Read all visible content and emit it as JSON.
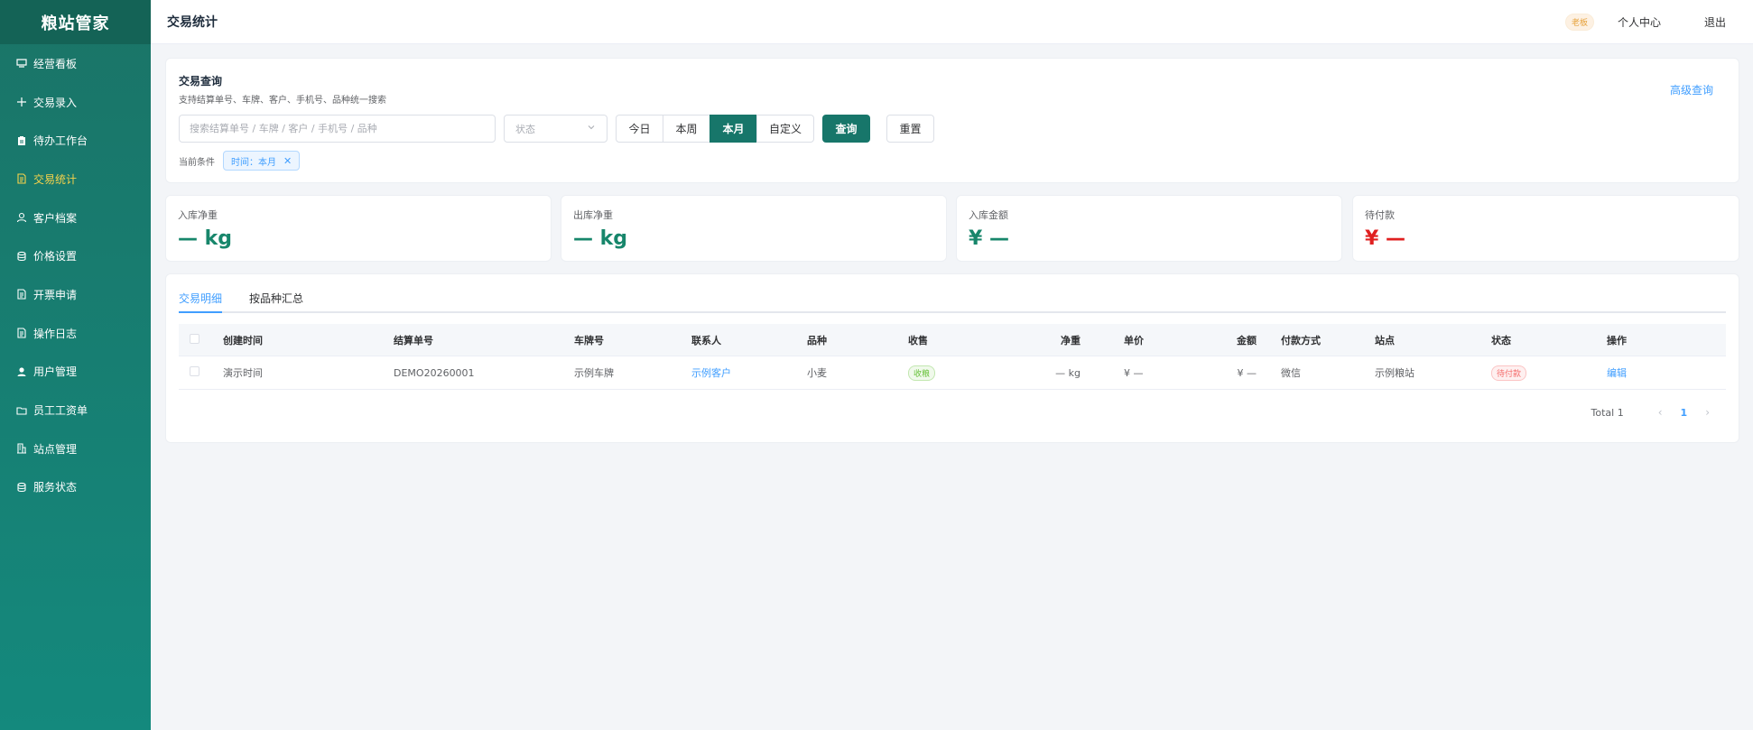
{
  "app": {
    "name": "粮站管家"
  },
  "sidebar": {
    "items": [
      {
        "label": "经营看板",
        "icon": "dashboard-icon"
      },
      {
        "label": "交易录入",
        "icon": "plus-icon"
      },
      {
        "label": "待办工作台",
        "icon": "clipboard-icon"
      },
      {
        "label": "交易统计",
        "icon": "document-icon",
        "active": true
      },
      {
        "label": "客户档案",
        "icon": "user-icon"
      },
      {
        "label": "价格设置",
        "icon": "database-icon"
      },
      {
        "label": "开票申请",
        "icon": "document-icon"
      },
      {
        "label": "操作日志",
        "icon": "document-icon"
      },
      {
        "label": "用户管理",
        "icon": "user-filled-icon"
      },
      {
        "label": "员工工资单",
        "icon": "folder-icon"
      },
      {
        "label": "站点管理",
        "icon": "building-icon"
      },
      {
        "label": "服务状态",
        "icon": "database-icon"
      }
    ]
  },
  "header": {
    "title": "交易统计",
    "role_badge": "老板",
    "profile_label": "个人中心",
    "logout_label": "退出"
  },
  "query": {
    "title": "交易查询",
    "subtitle": "支持结算单号、车牌、客户、手机号、品种统一搜索",
    "advanced_label": "高级查询",
    "search_placeholder": "搜索结算单号 / 车牌 / 客户 / 手机号 / 品种",
    "status_placeholder": "状态",
    "range_buttons": [
      "今日",
      "本周",
      "本月",
      "自定义"
    ],
    "active_range": "本月",
    "search_button": "查询",
    "reset_button": "重置",
    "condition_label": "当前条件",
    "condition_tag": "时间：本月"
  },
  "stats": [
    {
      "label": "入库净重",
      "value": "— kg",
      "color": "#17866b"
    },
    {
      "label": "出库净重",
      "value": "— kg",
      "color": "#17866b"
    },
    {
      "label": "入库金额",
      "value": "¥ —",
      "color": "#17866b"
    },
    {
      "label": "待付款",
      "value": "¥ —",
      "color": "#e02020"
    }
  ],
  "table": {
    "tabs": [
      "交易明细",
      "按品种汇总"
    ],
    "active_tab": "交易明细",
    "columns": [
      "创建时间",
      "结算单号",
      "车牌号",
      "联系人",
      "品种",
      "收售",
      "净重",
      "单价",
      "金额",
      "付款方式",
      "站点",
      "状态",
      "操作"
    ],
    "rows": [
      {
        "created": "演示时间",
        "order_no": "DEMO20260001",
        "plate": "示例车牌",
        "contact": "示例客户",
        "variety": "小麦",
        "direction": "收粮",
        "net_weight": "— kg",
        "unit_price": "¥ —",
        "amount": "¥ —",
        "payment": "微信",
        "station": "示例粮站",
        "status": "待付款",
        "action": "编辑"
      }
    ],
    "pagination": {
      "total_label": "Total 1",
      "current_page": "1",
      "prev": "‹",
      "next": "›"
    }
  }
}
